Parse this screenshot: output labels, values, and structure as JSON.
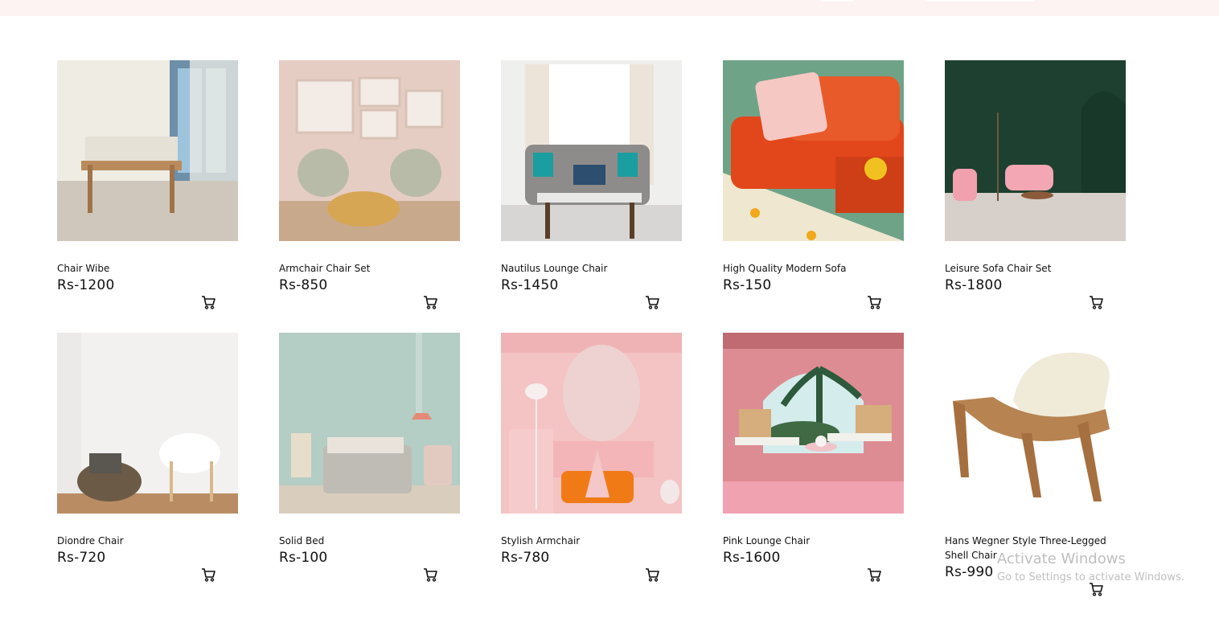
{
  "products": [
    {
      "name": "Chair Wibe",
      "price": "Rs-1200"
    },
    {
      "name": "Armchair Chair Set",
      "price": "Rs-850"
    },
    {
      "name": "Nautilus Lounge Chair",
      "price": "Rs-1450"
    },
    {
      "name": "High Quality Modern Sofa",
      "price": "Rs-150"
    },
    {
      "name": "Leisure Sofa Chair Set",
      "price": "Rs-1800"
    },
    {
      "name": "Diondre Chair",
      "price": "Rs-720"
    },
    {
      "name": "Solid Bed",
      "price": "Rs-100"
    },
    {
      "name": "Stylish Armchair",
      "price": "Rs-780"
    },
    {
      "name": "Pink Lounge Chair",
      "price": "Rs-1600"
    },
    {
      "name": "Hans Wegner Style Three-Legged Shell Chair",
      "price": "Rs-990"
    }
  ],
  "watermark": {
    "title": "Activate Windows",
    "subtitle": "Go to Settings to activate Windows."
  },
  "colors": {
    "topbar": "#fdf3f3"
  }
}
